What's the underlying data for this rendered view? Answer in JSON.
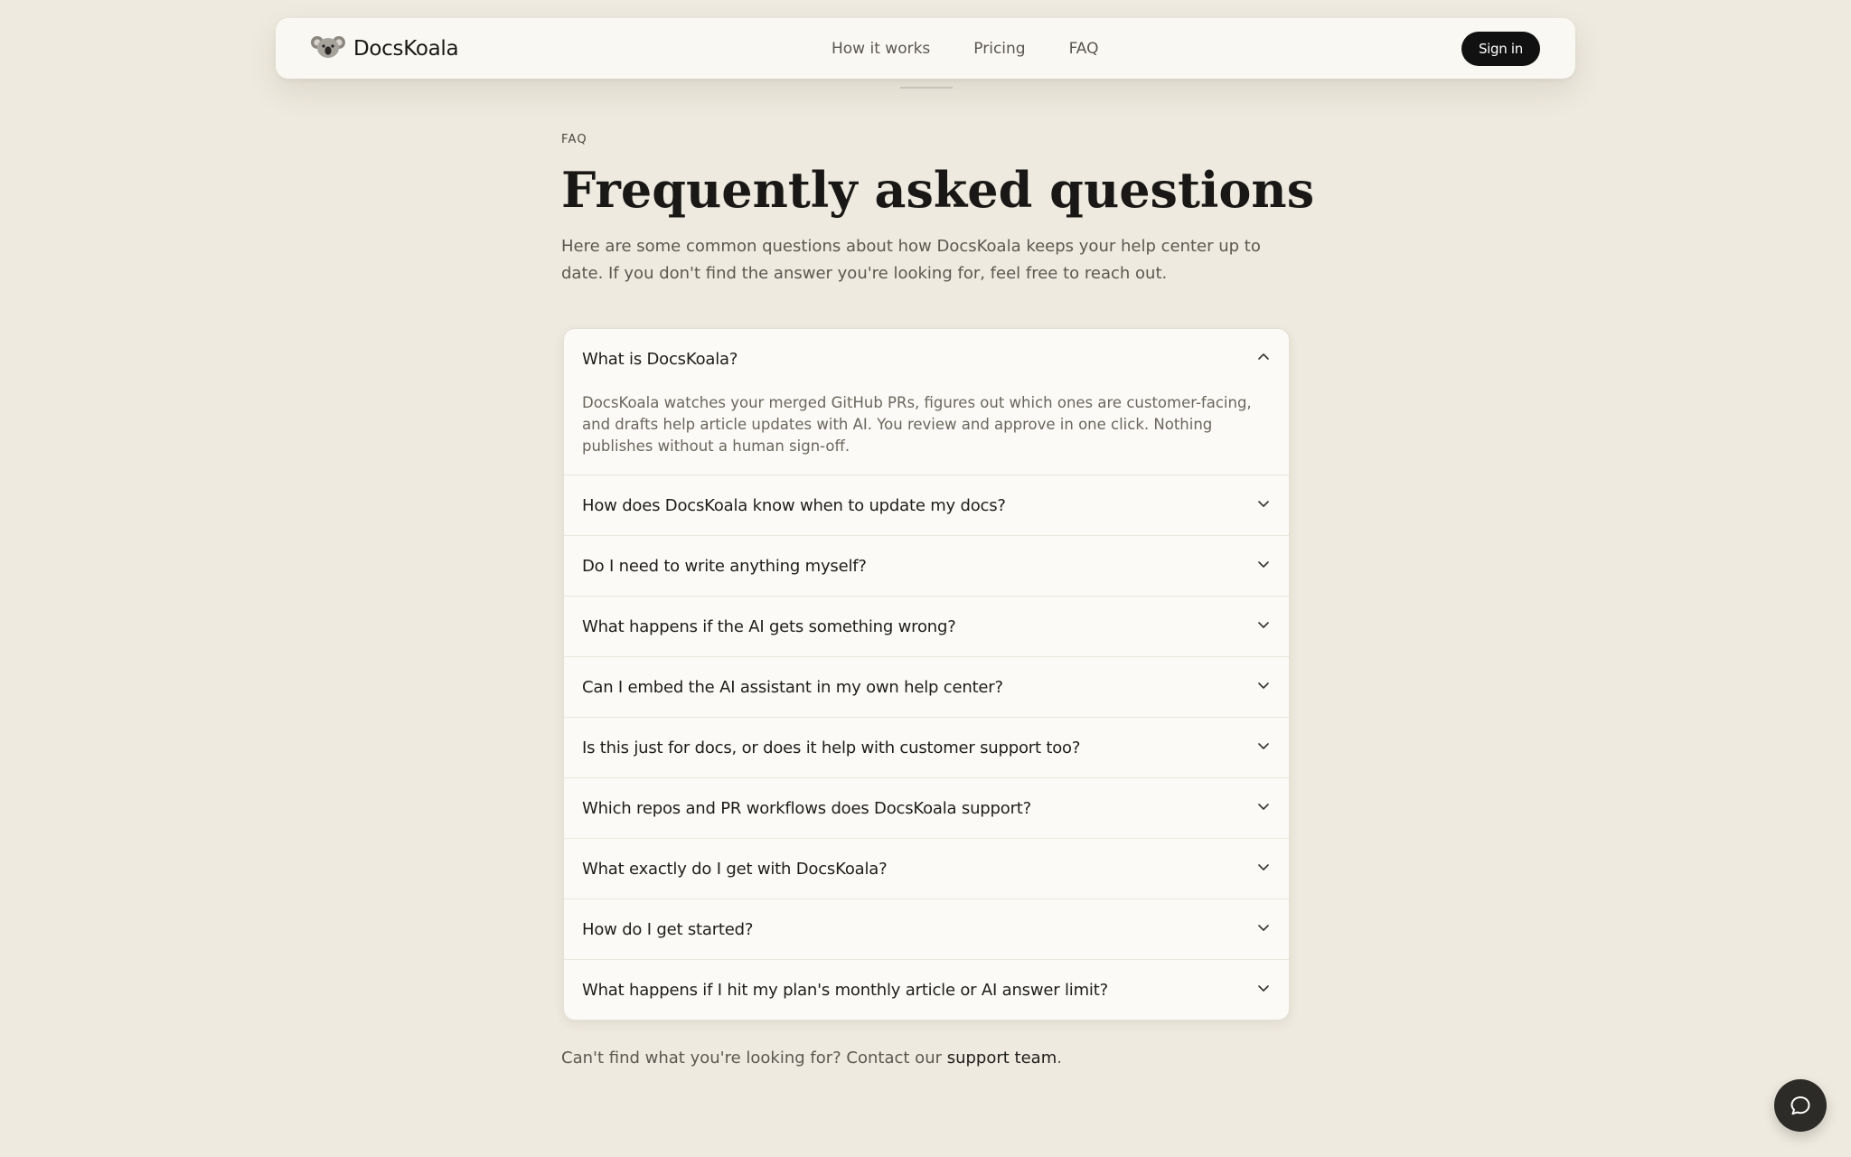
{
  "header": {
    "brand_name": "DocsKoala",
    "logo_icon": "koala-icon",
    "nav": [
      {
        "label": "How it works"
      },
      {
        "label": "Pricing"
      },
      {
        "label": "FAQ"
      }
    ],
    "signin_label": "Sign in"
  },
  "main": {
    "eyebrow": "FAQ",
    "title": "Frequently asked questions",
    "intro": "Here are some common questions about how DocsKoala keeps your help center up to date. If you don't find the answer you're looking for, feel free to reach out."
  },
  "faq": {
    "items": [
      {
        "question": "What is DocsKoala?",
        "expanded": true,
        "answer": "DocsKoala watches your merged GitHub PRs, figures out which ones are customer-facing, and drafts help article updates with AI. You review and approve in one click. Nothing publishes without a human sign-off."
      },
      {
        "question": "How does DocsKoala know when to update my docs?",
        "expanded": false
      },
      {
        "question": "Do I need to write anything myself?",
        "expanded": false
      },
      {
        "question": "What happens if the AI gets something wrong?",
        "expanded": false
      },
      {
        "question": "Can I embed the AI assistant in my own help center?",
        "expanded": false
      },
      {
        "question": "Is this just for docs, or does it help with customer support too?",
        "expanded": false
      },
      {
        "question": "Which repos and PR workflows does DocsKoala support?",
        "expanded": false
      },
      {
        "question": "What exactly do I get with DocsKoala?",
        "expanded": false
      },
      {
        "question": "How do I get started?",
        "expanded": false
      },
      {
        "question": "What happens if I hit my plan's monthly article or AI answer limit?",
        "expanded": false
      }
    ]
  },
  "footer": {
    "prefix": "Can't find what you're looking for? Contact our ",
    "link_label": "support team",
    "suffix": "."
  },
  "chat_button_icon": "chat-bubble-icon",
  "colors": {
    "background": "#eeeadf",
    "card": "#fbfaf6",
    "primary_button": "#111111",
    "chat_button": "#2d2b28"
  }
}
